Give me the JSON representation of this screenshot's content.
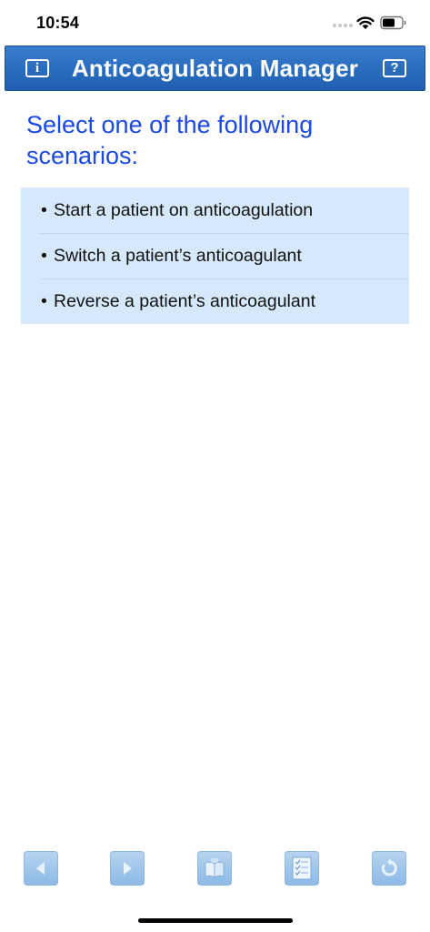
{
  "status_bar": {
    "time": "10:54",
    "icons": [
      "signal-dots-icon",
      "wifi-icon",
      "battery-icon"
    ]
  },
  "header": {
    "title": "Anticoagulation Manager",
    "info_glyph": "i",
    "help_glyph": "?",
    "icons": [
      "info-icon",
      "help-icon"
    ],
    "color": "#2a6dbf"
  },
  "main": {
    "prompt": "Select one of the following scenarios:",
    "prompt_color": "#1a49e6",
    "list_background": "#d6e8fb",
    "scenarios": [
      {
        "bullet": "•",
        "label": "Start a patient on anticoagulation"
      },
      {
        "bullet": "•",
        "label": "Switch a patient’s anticoagulant"
      },
      {
        "bullet": "•",
        "label": "Reverse a patient’s anticoagulant"
      }
    ]
  },
  "toolbar": {
    "icons": [
      "back-arrow-icon",
      "forward-arrow-icon",
      "book-icon",
      "checklist-icon",
      "refresh-icon"
    ],
    "button_color": "#a4c8ec"
  }
}
